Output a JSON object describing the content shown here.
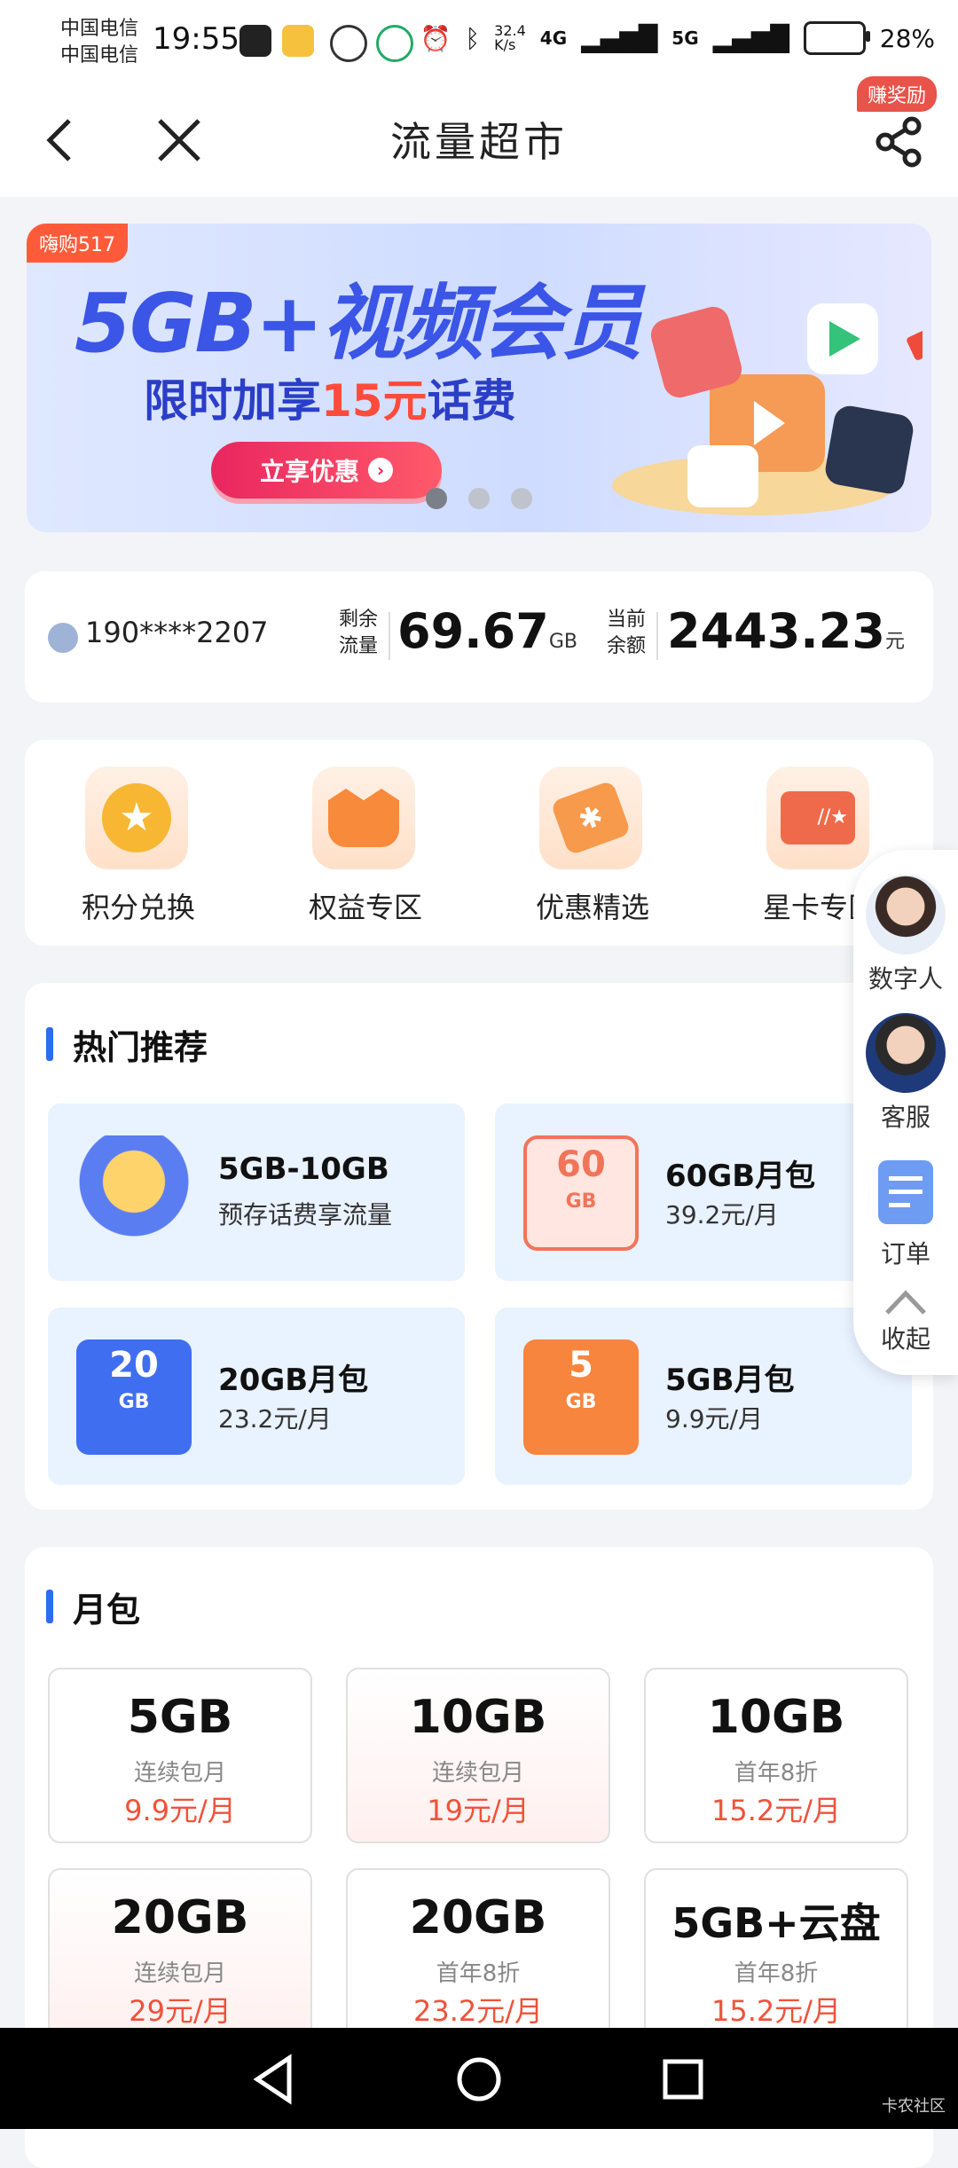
{
  "status_bar": {
    "carrier_1": "中国电信",
    "carrier_2": "中国电信",
    "time": "19:55",
    "net_speed": "32.4\nK/s",
    "signal_1": "4G",
    "signal_2": "5G",
    "battery": "28%"
  },
  "header": {
    "title": "流量超市",
    "reward_badge": "赚奖励"
  },
  "banner": {
    "tag": "嗨购517",
    "headline": "5GB+视频会员",
    "subline_prefix": "限时加享",
    "subline_highlight": "15元",
    "subline_suffix": "话费",
    "button": "立享优惠"
  },
  "stats": {
    "phone": "190****2207",
    "data_label_1": "剩余",
    "data_label_2": "流量",
    "data_value": "69.67",
    "data_unit": "GB",
    "balance_label_1": "当前",
    "balance_label_2": "余额",
    "balance_value": "2443.23",
    "balance_unit": "元"
  },
  "quick_links": [
    {
      "label": "积分兑换"
    },
    {
      "label": "权益专区"
    },
    {
      "label": "优惠精选"
    },
    {
      "label": "星卡专区"
    }
  ],
  "floating_menu": {
    "digital_human": "数字人",
    "service": "客服",
    "orders": "订单",
    "collapse": "收起"
  },
  "hot": {
    "title": "热门推荐",
    "cards": [
      {
        "title": "5GB-10GB",
        "sub": "预存话费享流量"
      },
      {
        "title": "60GB月包",
        "sub": "39.2元/月",
        "img_text": "60",
        "img_sub": "GB"
      },
      {
        "title": "20GB月包",
        "sub": "23.2元/月",
        "img_text": "20",
        "img_sub": "GB"
      },
      {
        "title": "5GB月包",
        "sub": "9.9元/月",
        "img_text": "5",
        "img_sub": "GB"
      }
    ]
  },
  "monthly": {
    "title": "月包",
    "packages": [
      {
        "gb": "5GB",
        "sub": "连续包月",
        "price": "9.9元/月"
      },
      {
        "gb": "10GB",
        "sub": "连续包月",
        "price": "19元/月"
      },
      {
        "gb": "10GB",
        "sub": "首年8折",
        "price": "15.2元/月"
      },
      {
        "gb": "20GB",
        "sub": "连续包月",
        "price": "29元/月"
      },
      {
        "gb": "20GB",
        "sub": "首年8折",
        "price": "23.2元/月"
      },
      {
        "gb": "5GB+云盘",
        "sub": "首年8折",
        "price": "15.2元/月"
      }
    ]
  },
  "watermark": "卡农社区"
}
